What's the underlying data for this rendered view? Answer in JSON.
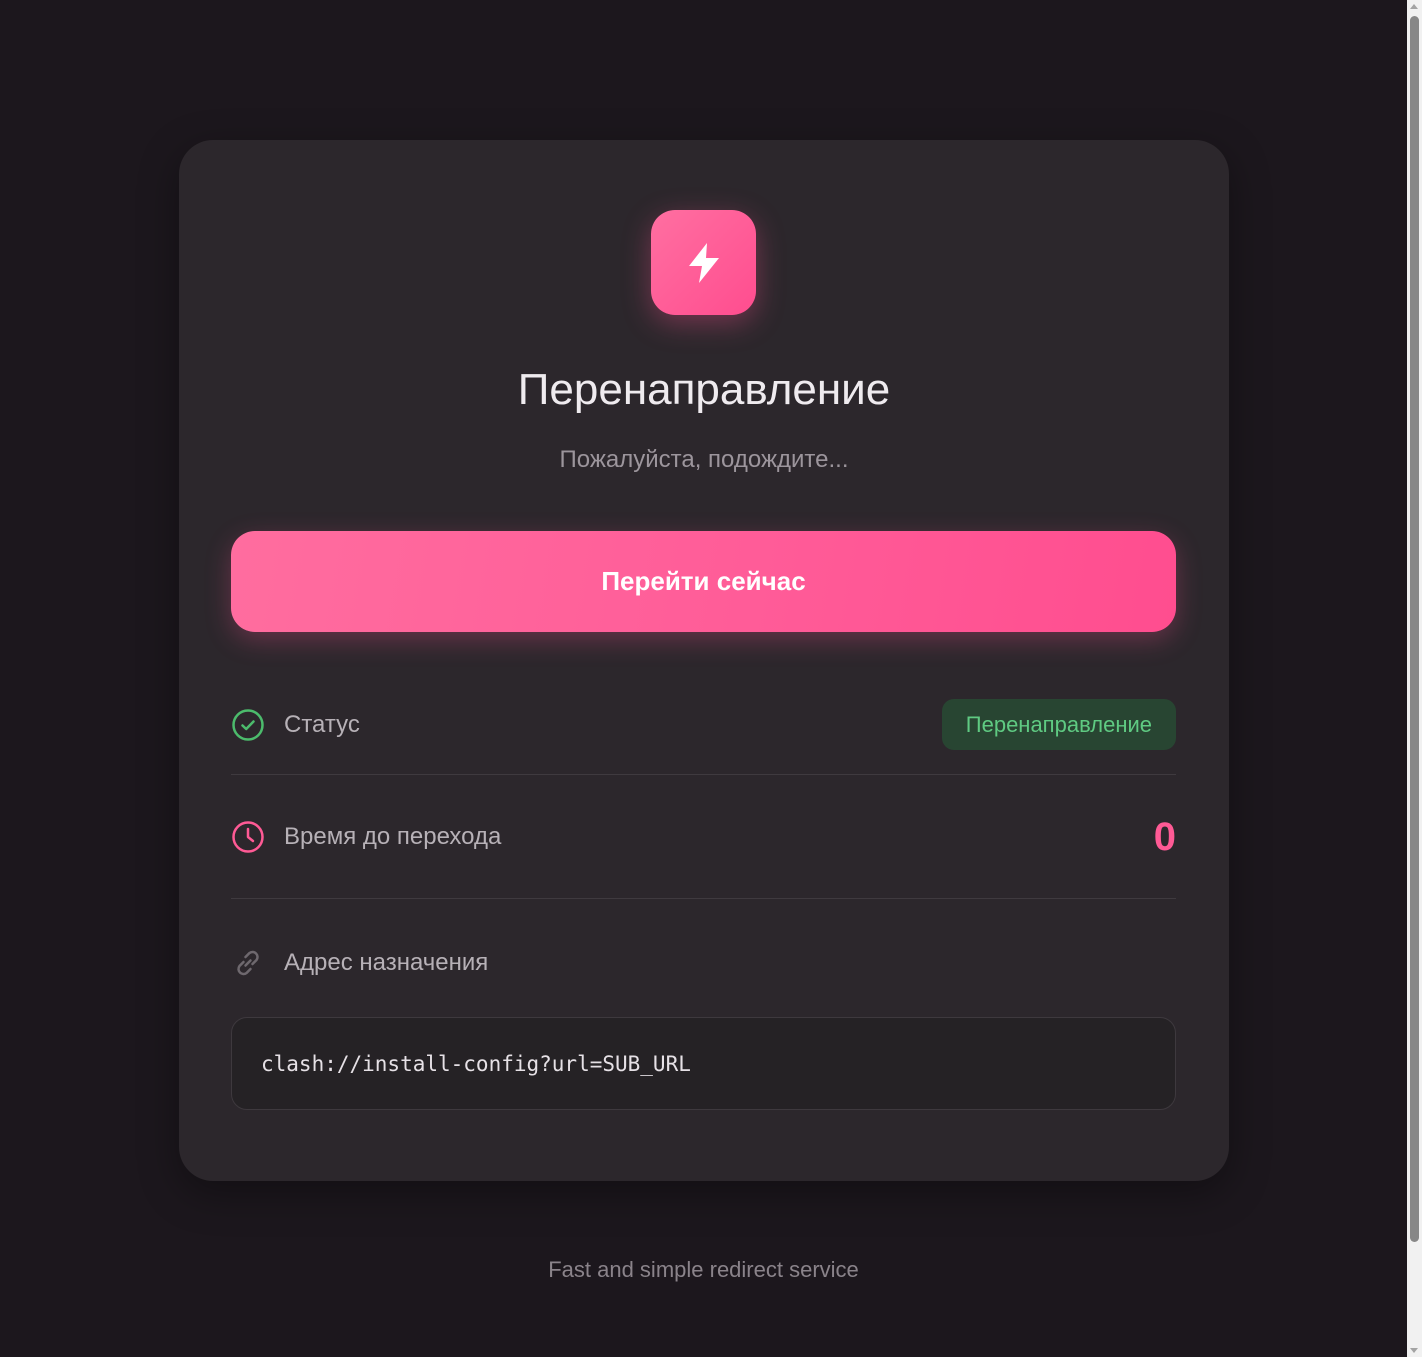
{
  "card": {
    "title": "Перенаправление",
    "subtitle": "Пожалуйста, подождите...",
    "go_button_label": "Перейти сейчас",
    "logo_icon": "lightning-icon"
  },
  "status_row": {
    "label": "Статус",
    "badge": "Перенаправление",
    "icon": "check-circle-icon"
  },
  "time_row": {
    "label": "Время до перехода",
    "value": "0",
    "icon": "clock-icon"
  },
  "destination": {
    "label": "Адрес назначения",
    "url": "clash://install-config?url=SUB_URL",
    "icon": "link-icon"
  },
  "footer": {
    "text": "Fast and simple redirect service"
  },
  "colors": {
    "page_bg": "#1c171d",
    "card_bg": "#2c272c",
    "accent": "#ff5a95",
    "success": "#5fca82",
    "success_bg": "#284532"
  }
}
